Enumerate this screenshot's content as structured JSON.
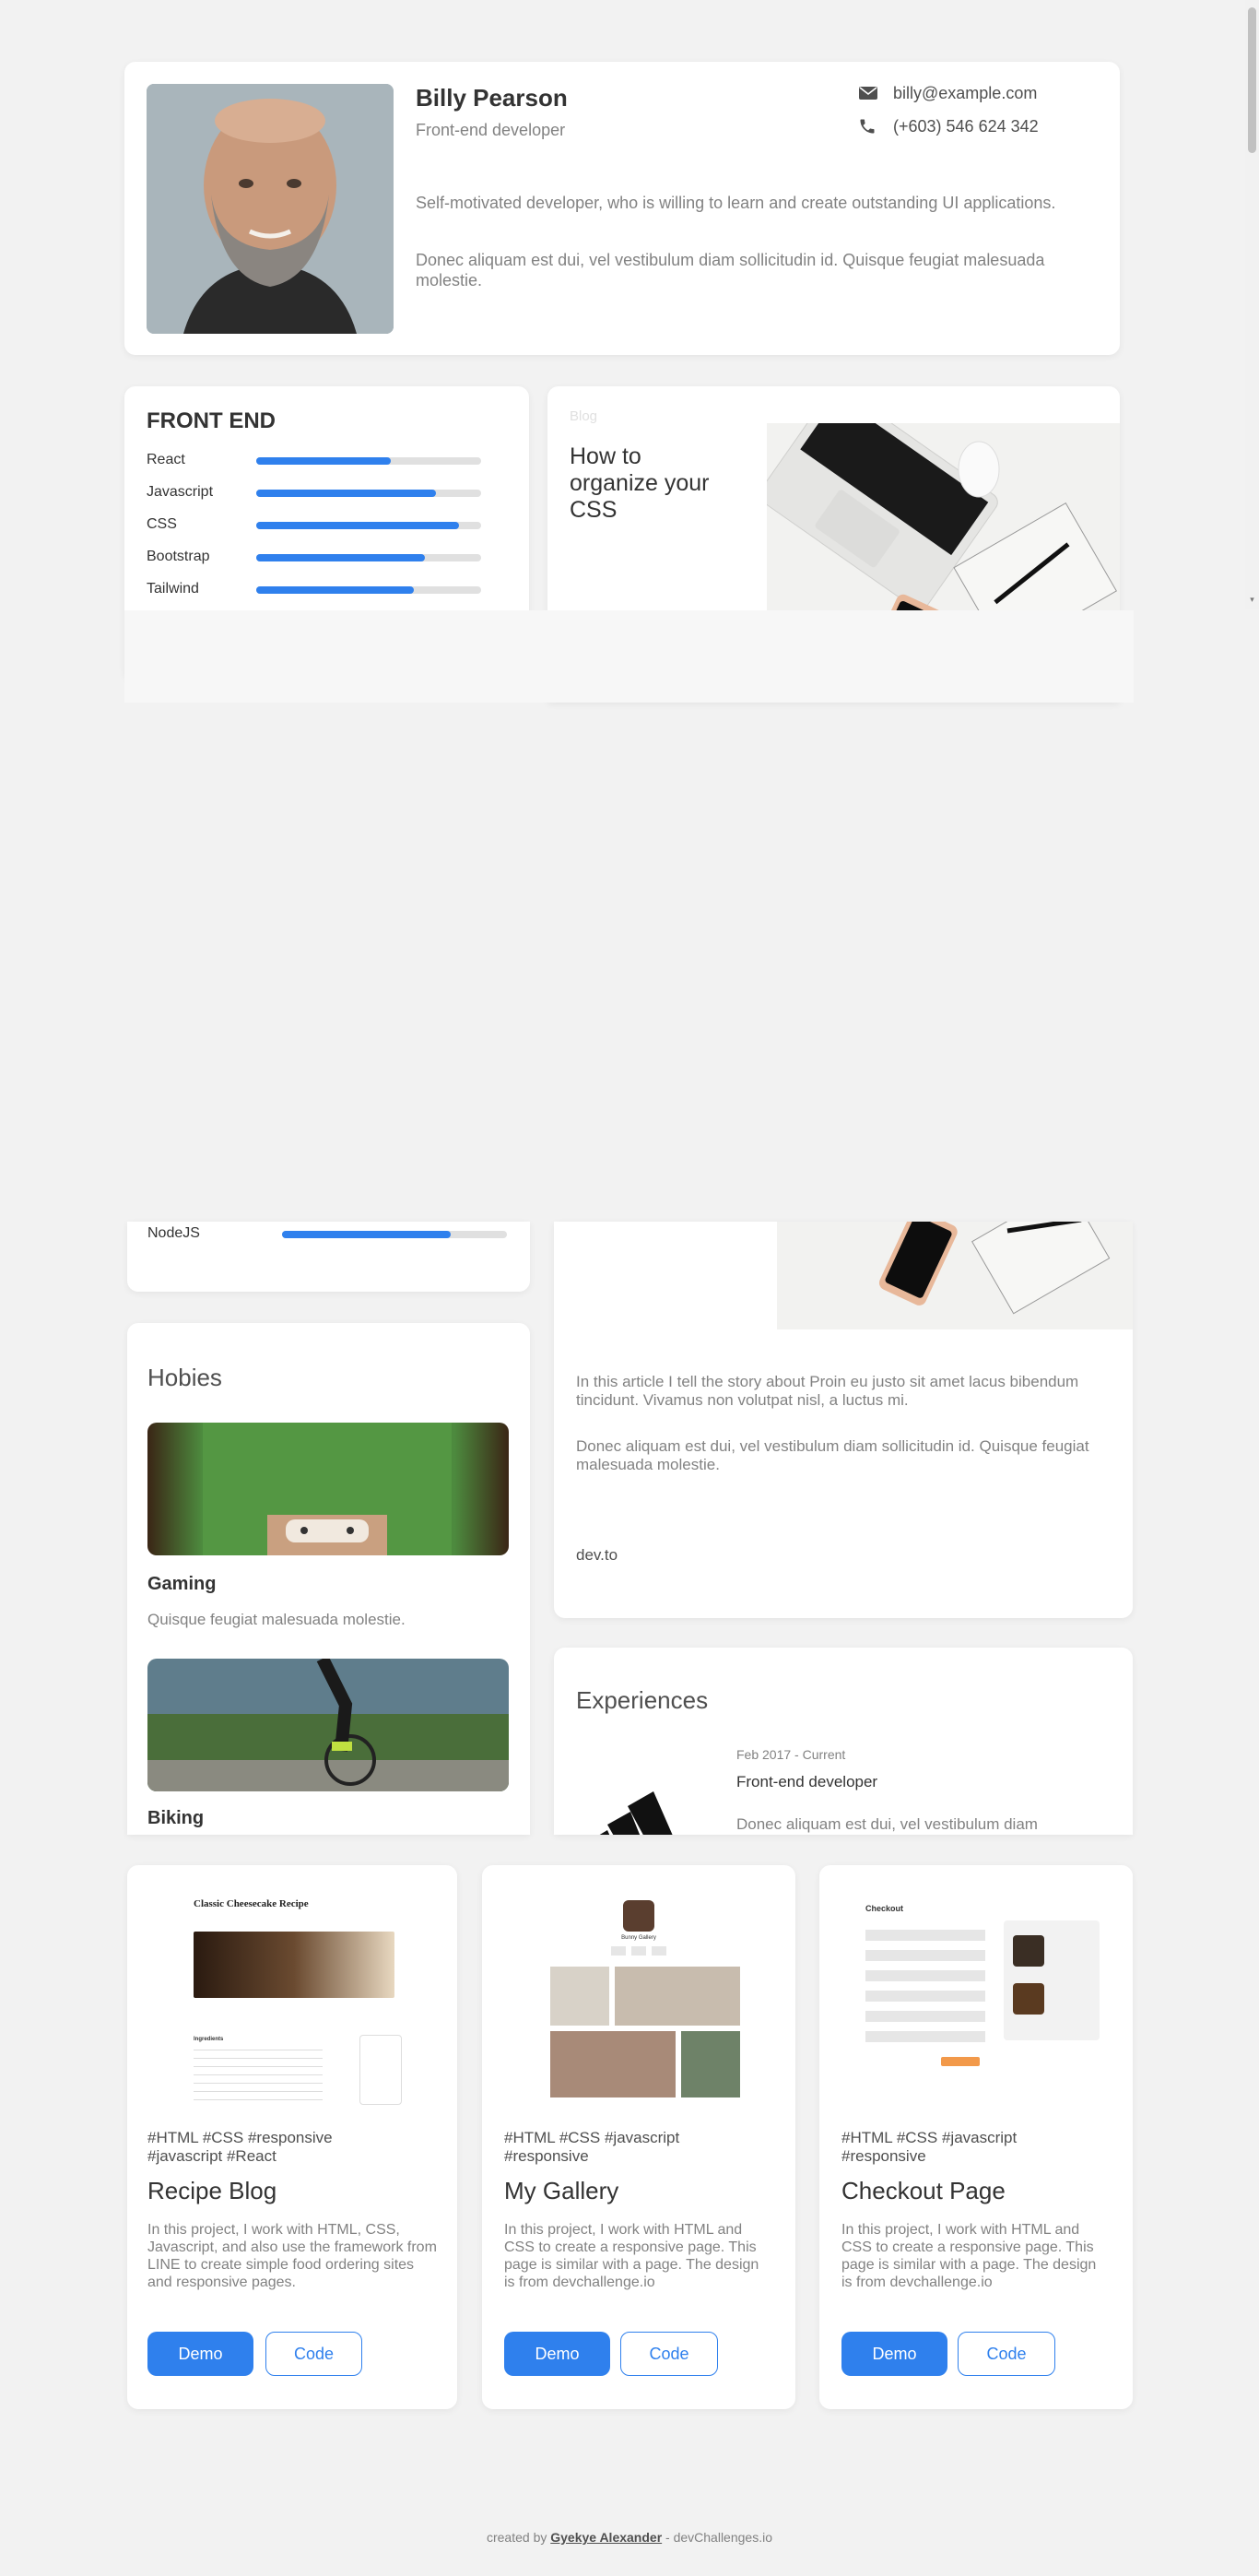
{
  "profile": {
    "name": "Billy Pearson",
    "role": "Front-end developer",
    "email": "billy@example.com",
    "phone": "(+603) 546 624 342",
    "bio1": "Self-motivated developer, who is willing to learn and create outstanding UI applications.",
    "bio2": "Donec aliquam est dui, vel vestibulum diam sollicitudin id. Quisque feugiat malesuada molestie."
  },
  "skills": {
    "title": "FRONT END",
    "items": [
      {
        "label": "React",
        "level": 0.6
      },
      {
        "label": "Javascript",
        "level": 0.8
      },
      {
        "label": "CSS",
        "level": 0.9
      },
      {
        "label": "Bootstrap",
        "level": 0.75
      },
      {
        "label": "Tailwind",
        "level": 0.7
      },
      {
        "label": "NodeJS",
        "level": 0.75
      }
    ]
  },
  "blog": {
    "label": "Blog",
    "title": "How to organize your CSS",
    "p1": "In this article I tell the story about Proin eu justo sit amet lacus bibendum tincidunt. Vivamus non volutpat nisl, a luctus mi.",
    "p2": "Donec aliquam est dui, vel vestibulum diam sollicitudin id. Quisque feugiat malesuada molestie.",
    "source": "dev.to"
  },
  "hobbies": {
    "title": "Hobies",
    "items": [
      {
        "name": "Gaming",
        "desc": "Quisque feugiat malesuada molestie."
      },
      {
        "name": "Biking",
        "desc": ""
      }
    ]
  },
  "experiences": {
    "title": "Experiences",
    "date": "Feb 2017 - Current",
    "role": "Front-end developer",
    "desc": "Donec aliquam est dui, vel vestibulum diam"
  },
  "projects": [
    {
      "tags": "#HTML  #CSS  #responsive\n#javascript  #React",
      "title": "Recipe Blog",
      "desc": "In this project, I work with HTML, CSS, Javascript, and also use the framework from LINE to create simple food ordering sites and responsive pages.",
      "demo": "Demo",
      "code": "Code",
      "thumb_title": "Classic Cheesecake Recipe",
      "thumb_sub": "Ingredients"
    },
    {
      "tags": "#HTML  #CSS  #javascript\n#responsive",
      "title": "My Gallery",
      "desc": "In this project, I work with HTML and CSS to create a responsive page. This page is similar with a page. The design is from devchallenge.io",
      "demo": "Demo",
      "code": "Code",
      "thumb_title": "Bunny Gallery"
    },
    {
      "tags": "#HTML  #CSS  #javascript\n#responsive",
      "title": "Checkout Page",
      "desc": "In this project, I work with HTML and CSS to create a responsive page. This page is similar with a page. The design is from devchallenge.io",
      "demo": "Demo",
      "code": "Code",
      "thumb_title": "Checkout"
    }
  ],
  "footer": {
    "prefix": "created by ",
    "author": "Gyekye Alexander",
    "suffix": " - devChallenges.io"
  },
  "colors": {
    "accent": "#2f80ed",
    "background": "#f2f2f2",
    "card": "#ffffff"
  },
  "icons": {
    "email": "mail-icon",
    "phone": "phone-icon"
  }
}
